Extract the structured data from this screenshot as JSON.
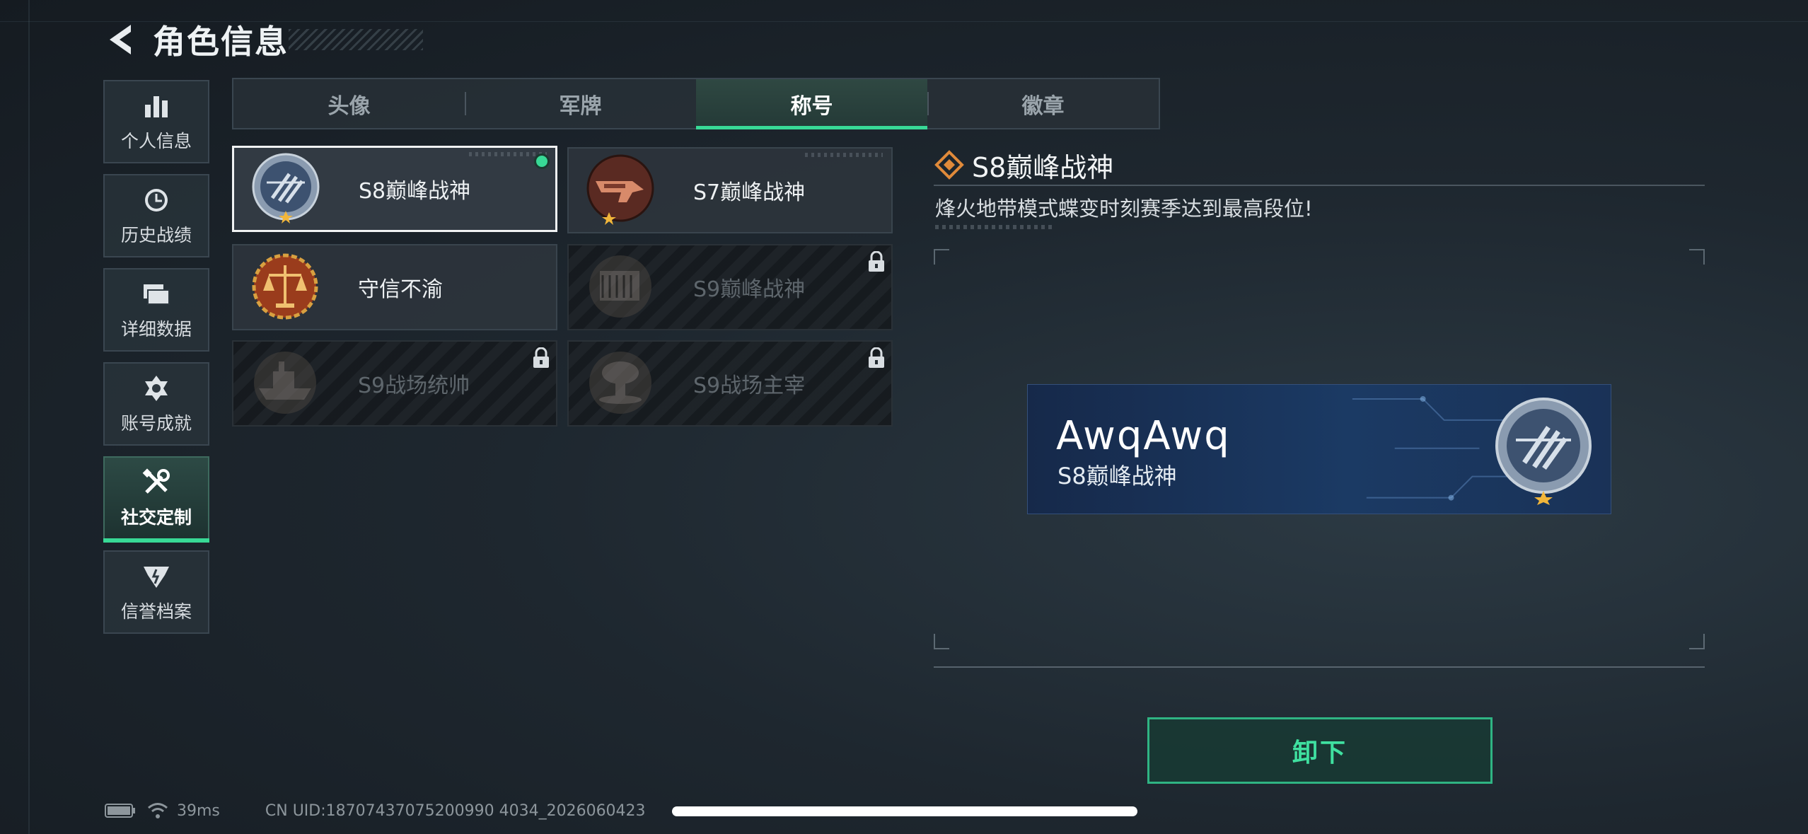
{
  "header": {
    "title": "角色信息"
  },
  "sidebar": {
    "items": [
      {
        "label": "个人信息",
        "icon": "bar-chart-icon"
      },
      {
        "label": "历史战绩",
        "icon": "clock-icon"
      },
      {
        "label": "详细数据",
        "icon": "folders-icon"
      },
      {
        "label": "账号成就",
        "icon": "medal-icon"
      },
      {
        "label": "社交定制",
        "icon": "tools-icon",
        "active": true
      },
      {
        "label": "信誉档案",
        "icon": "shield-wing-icon"
      }
    ]
  },
  "tabs": [
    {
      "label": "头像"
    },
    {
      "label": "军牌"
    },
    {
      "label": "称号",
      "active": true
    },
    {
      "label": "徽章"
    }
  ],
  "titles": [
    {
      "name": "S8巅峰战神",
      "state": "equipped",
      "emblem": "s8-emblem-icon"
    },
    {
      "name": "S7巅峰战神",
      "state": "owned",
      "emblem": "s7-emblem-icon"
    },
    {
      "name": "守信不渝",
      "state": "owned",
      "emblem": "scales-emblem-icon"
    },
    {
      "name": "S9巅峰战神",
      "state": "locked",
      "emblem": "s9-building-emblem-icon"
    },
    {
      "name": "S9战场统帅",
      "state": "locked",
      "emblem": "s9-ship-emblem-icon"
    },
    {
      "name": "S9战场主宰",
      "state": "locked",
      "emblem": "s9-mushroom-emblem-icon"
    }
  ],
  "detail": {
    "title": "S8巅峰战神",
    "description": "烽火地带模式蝶变时刻赛季达到最高段位!"
  },
  "preview": {
    "player_name": "AwqAwq",
    "player_title": "S8巅峰战神"
  },
  "actions": {
    "unequip_label": "卸下"
  },
  "status": {
    "ping": "39ms",
    "uid": "CN UID:18707437075200990 4034_2026060423"
  },
  "colors": {
    "accent": "#38d996",
    "nameplate": "#1b3a64"
  }
}
